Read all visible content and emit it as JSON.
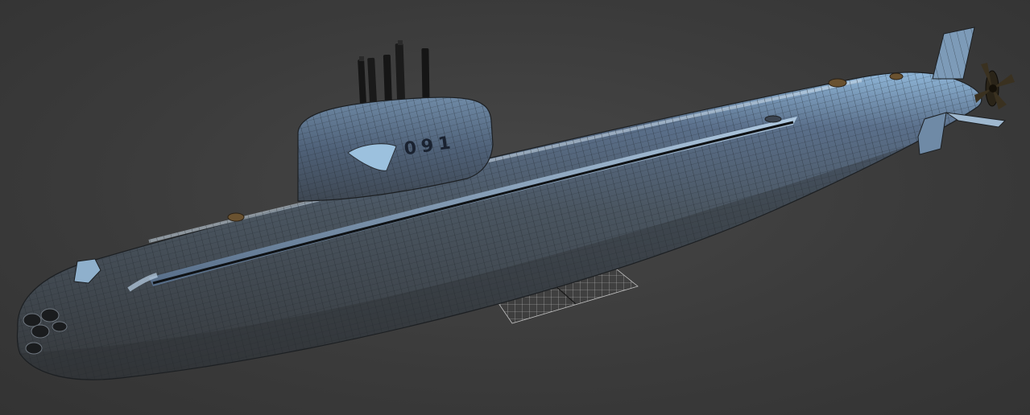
{
  "viewport": {
    "background_color": "#3a3a3a",
    "model": {
      "name": "submarine",
      "display_mode": "wireframe-over-shaded",
      "hull_number": "091",
      "colors": {
        "hull_light": "#5a6f8a",
        "hull_mid": "#4a5560",
        "hull_dark": "#3a3d40",
        "highlight": "#8fb6d8",
        "wire": "#1e2328",
        "mast": "#161616",
        "propeller": "#2a2418",
        "grid": "#cfcfcf"
      }
    },
    "ground_grid": {
      "visible": true
    }
  }
}
